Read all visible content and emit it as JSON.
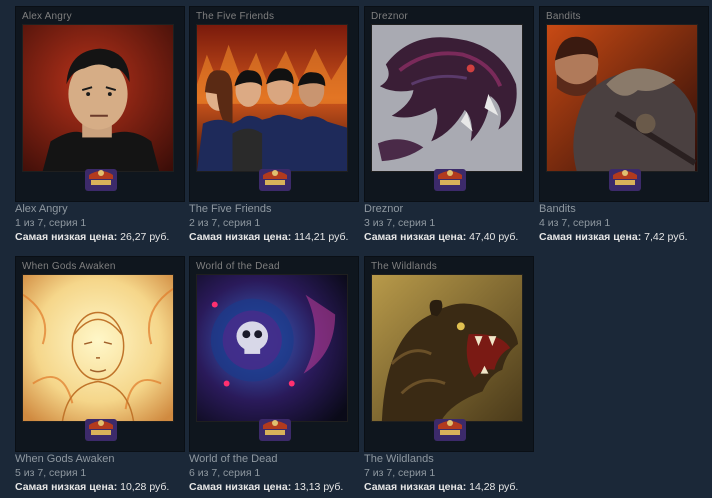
{
  "cards": [
    {
      "frame_title": "Alex Angry",
      "name": "Alex Angry",
      "series": "1 из 7, серия 1",
      "price_label": "Самая низкая цена:",
      "price": "26,27 руб.",
      "art_icon": "portrait-man-icon"
    },
    {
      "frame_title": "The Five Friends",
      "name": "The Five Friends",
      "series": "2 из 7, серия 1",
      "price_label": "Самая низкая цена:",
      "price": "114,21 руб.",
      "art_icon": "group-portrait-icon"
    },
    {
      "frame_title": "Dreznor",
      "name": "Dreznor",
      "series": "3 из 7, серия 1",
      "price_label": "Самая низкая цена:",
      "price": "47,40 руб.",
      "art_icon": "dragon-icon"
    },
    {
      "frame_title": "Bandits",
      "name": "Bandits",
      "series": "4 из 7, серия 1",
      "price_label": "Самая низкая цена:",
      "price": "7,42 руб.",
      "art_icon": "bandit-icon"
    },
    {
      "frame_title": "When Gods Awaken",
      "name": "When Gods Awaken",
      "series": "5 из 7, серия 1",
      "price_label": "Самая низкая цена:",
      "price": "10,28 руб.",
      "art_icon": "glowing-god-icon"
    },
    {
      "frame_title": "World of the Dead",
      "name": "World of the Dead",
      "series": "6 из 7, серия 1",
      "price_label": "Самая низкая цена:",
      "price": "13,13 руб.",
      "art_icon": "skull-orb-icon"
    },
    {
      "frame_title": "The Wildlands",
      "name": "The Wildlands",
      "series": "7 из 7, серия 1",
      "price_label": "Самая низкая цена:",
      "price": "14,28 руб.",
      "art_icon": "roaring-bear-icon"
    }
  ],
  "colors": {
    "background": "#1b2838",
    "muted_text": "#8f98a0",
    "price_text": "#e6e6e6"
  }
}
